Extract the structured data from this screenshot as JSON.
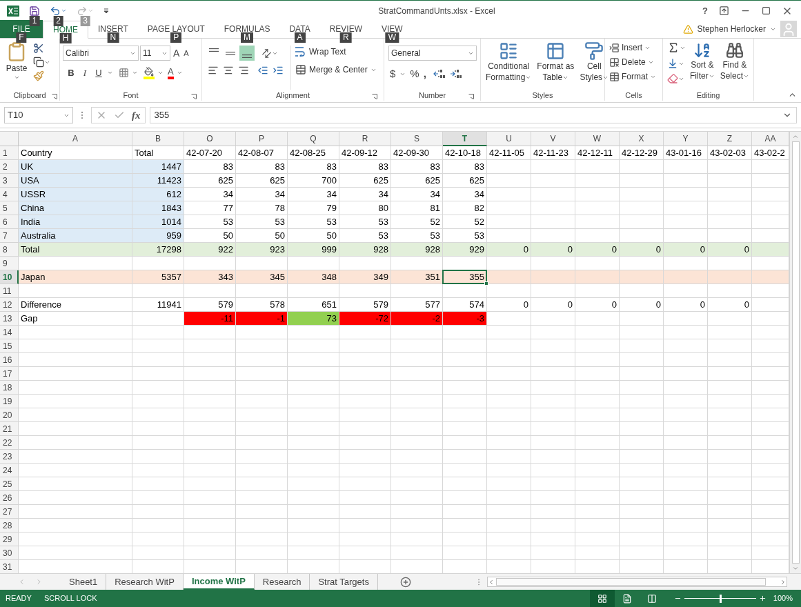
{
  "window": {
    "title": "StratCommandUnts.xlsx - Excel",
    "help": "?"
  },
  "quick_access": [
    {
      "kind": "save",
      "key_tip": "1",
      "disabled": false
    },
    {
      "kind": "undo",
      "key_tip": "2",
      "disabled": false
    },
    {
      "kind": "redo",
      "key_tip": "3",
      "disabled": true
    }
  ],
  "tabs": [
    {
      "kind": "file",
      "label": "FILE",
      "key_tip": "F",
      "selected": false
    },
    {
      "kind": "tab",
      "label": "HOME",
      "key_tip": "H",
      "selected": true
    },
    {
      "kind": "tab",
      "label": "INSERT",
      "key_tip": "N",
      "selected": false
    },
    {
      "kind": "tab",
      "label": "PAGE LAYOUT",
      "key_tip": "P",
      "selected": false
    },
    {
      "kind": "tab",
      "label": "FORMULAS",
      "key_tip": "M",
      "selected": false
    },
    {
      "kind": "tab",
      "label": "DATA",
      "key_tip": "A",
      "selected": false
    },
    {
      "kind": "tab",
      "label": "REVIEW",
      "key_tip": "R",
      "selected": false
    },
    {
      "kind": "tab",
      "label": "VIEW",
      "key_tip": "W",
      "selected": false
    }
  ],
  "user": {
    "name": "Stephen Herlocker"
  },
  "ribbon": {
    "groups": [
      {
        "kind": "clipboard",
        "title": "Clipboard",
        "paste": "Paste"
      },
      {
        "kind": "font",
        "title": "Font",
        "font_name": "Calibri",
        "font_size": "11",
        "grow": "A",
        "shrink": "A",
        "styles": [
          "B",
          "I",
          "U"
        ],
        "font_color": "A"
      },
      {
        "kind": "alignment",
        "title": "Alignment",
        "vertical": [
          {
            "selected": false
          },
          {
            "selected": false
          },
          {
            "selected": true
          }
        ],
        "wrap_text": "Wrap Text",
        "merge": "Merge & Center"
      },
      {
        "kind": "number",
        "title": "Number",
        "format": "General",
        "symbols": [
          "$",
          "%",
          ","
        ]
      },
      {
        "kind": "styles",
        "title": "Styles",
        "buttons": [
          {
            "lines": [
              "Conditional",
              "Formatting"
            ]
          },
          {
            "lines": [
              "Format as",
              "Table"
            ]
          },
          {
            "lines": [
              "Cell",
              "Styles"
            ]
          }
        ]
      },
      {
        "kind": "cells",
        "title": "Cells",
        "buttons": [
          "Insert",
          "Delete",
          "Format"
        ]
      },
      {
        "kind": "editing",
        "title": "Editing",
        "buttons": [
          {
            "lines": [
              "Sort &",
              "Filter"
            ]
          },
          {
            "lines": [
              "Find &",
              "Select"
            ]
          }
        ]
      }
    ]
  },
  "formula_bar": {
    "name_box": "T10",
    "function_label": "fx",
    "value": "355"
  },
  "sheet": {
    "columns": [
      {
        "label": "A",
        "selected": false
      },
      {
        "label": "B",
        "selected": false
      },
      {
        "label": "O",
        "selected": false
      },
      {
        "label": "P",
        "selected": false
      },
      {
        "label": "Q",
        "selected": false
      },
      {
        "label": "R",
        "selected": false
      },
      {
        "label": "S",
        "selected": false
      },
      {
        "label": "T",
        "selected": true
      },
      {
        "label": "U",
        "selected": false
      },
      {
        "label": "V",
        "selected": false
      },
      {
        "label": "W",
        "selected": false
      },
      {
        "label": "X",
        "selected": false
      },
      {
        "label": "Y",
        "selected": false
      },
      {
        "label": "Z",
        "selected": false
      },
      {
        "label": "AA",
        "selected": false
      }
    ],
    "rows": [
      {
        "label": "1",
        "selected": false,
        "cells": [
          {
            "text": "Country"
          },
          {
            "text": "Total"
          },
          {
            "text": "42-07-20"
          },
          {
            "text": "42-08-07"
          },
          {
            "text": "42-08-25"
          },
          {
            "text": "42-09-12"
          },
          {
            "text": "42-09-30"
          },
          {
            "text": "42-10-18"
          },
          {
            "text": "42-11-05"
          },
          {
            "text": "42-11-23"
          },
          {
            "text": "42-12-11"
          },
          {
            "text": "42-12-29"
          },
          {
            "text": "43-01-16"
          },
          {
            "text": "43-02-03"
          },
          {
            "text": "43-02-2"
          }
        ]
      },
      {
        "label": "2",
        "selected": false,
        "cells": [
          {
            "text": "UK",
            "color": "#ddebf7"
          },
          {
            "text": "1447",
            "color": "#ddebf7"
          },
          {
            "text": "83"
          },
          {
            "text": "83"
          },
          {
            "text": "83"
          },
          {
            "text": "83"
          },
          {
            "text": "83"
          },
          {
            "text": "83"
          }
        ]
      },
      {
        "label": "3",
        "selected": false,
        "cells": [
          {
            "text": "USA",
            "color": "#ddebf7"
          },
          {
            "text": "11423",
            "color": "#ddebf7"
          },
          {
            "text": "625"
          },
          {
            "text": "625"
          },
          {
            "text": "700"
          },
          {
            "text": "625"
          },
          {
            "text": "625"
          },
          {
            "text": "625"
          }
        ]
      },
      {
        "label": "4",
        "selected": false,
        "cells": [
          {
            "text": "USSR",
            "color": "#ddebf7"
          },
          {
            "text": "612",
            "color": "#ddebf7"
          },
          {
            "text": "34"
          },
          {
            "text": "34"
          },
          {
            "text": "34"
          },
          {
            "text": "34"
          },
          {
            "text": "34"
          },
          {
            "text": "34"
          }
        ]
      },
      {
        "label": "5",
        "selected": false,
        "cells": [
          {
            "text": "China",
            "color": "#ddebf7"
          },
          {
            "text": "1843",
            "color": "#ddebf7"
          },
          {
            "text": "77"
          },
          {
            "text": "78"
          },
          {
            "text": "79"
          },
          {
            "text": "80"
          },
          {
            "text": "81"
          },
          {
            "text": "82"
          }
        ]
      },
      {
        "label": "6",
        "selected": false,
        "cells": [
          {
            "text": "India",
            "color": "#ddebf7"
          },
          {
            "text": "1014",
            "color": "#ddebf7"
          },
          {
            "text": "53"
          },
          {
            "text": "53"
          },
          {
            "text": "53"
          },
          {
            "text": "53"
          },
          {
            "text": "52"
          },
          {
            "text": "52"
          }
        ]
      },
      {
        "label": "7",
        "selected": false,
        "cells": [
          {
            "text": "Australia",
            "color": "#ddebf7"
          },
          {
            "text": "959",
            "color": "#ddebf7"
          },
          {
            "text": "50"
          },
          {
            "text": "50"
          },
          {
            "text": "50"
          },
          {
            "text": "53"
          },
          {
            "text": "53"
          },
          {
            "text": "53"
          }
        ]
      },
      {
        "label": "8",
        "selected": false,
        "cells": [
          {
            "text": "Total",
            "color": "#e2efda"
          },
          {
            "text": "17298",
            "color": "#e2efda"
          },
          {
            "text": "922",
            "color": "#e2efda"
          },
          {
            "text": "923",
            "color": "#e2efda"
          },
          {
            "text": "999",
            "color": "#e2efda"
          },
          {
            "text": "928",
            "color": "#e2efda"
          },
          {
            "text": "928",
            "color": "#e2efda"
          },
          {
            "text": "929",
            "color": "#e2efda"
          },
          {
            "text": "0",
            "color": "#e2efda"
          },
          {
            "text": "0",
            "color": "#e2efda"
          },
          {
            "text": "0",
            "color": "#e2efda"
          },
          {
            "text": "0",
            "color": "#e2efda"
          },
          {
            "text": "0",
            "color": "#e2efda"
          },
          {
            "text": "0",
            "color": "#e2efda"
          },
          {
            "color": "#e2efda"
          }
        ]
      },
      {
        "label": "9",
        "selected": false
      },
      {
        "label": "10",
        "selected": true,
        "cells": [
          {
            "text": "Japan",
            "color": "#fce4d6"
          },
          {
            "text": "5357",
            "color": "#fce4d6"
          },
          {
            "text": "343",
            "color": "#fce4d6"
          },
          {
            "text": "345",
            "color": "#fce4d6"
          },
          {
            "text": "348",
            "color": "#fce4d6"
          },
          {
            "text": "349",
            "color": "#fce4d6"
          },
          {
            "text": "351",
            "color": "#fce4d6"
          },
          {
            "text": "355",
            "color": "#fce4d6",
            "active": true
          },
          {
            "color": "#fce4d6"
          },
          {
            "color": "#fce4d6"
          },
          {
            "color": "#fce4d6"
          },
          {
            "color": "#fce4d6"
          },
          {
            "color": "#fce4d6"
          },
          {
            "color": "#fce4d6"
          },
          {
            "color": "#fce4d6"
          }
        ]
      },
      {
        "label": "11",
        "selected": false
      },
      {
        "label": "12",
        "selected": false,
        "cells": [
          {
            "text": "Difference"
          },
          {
            "text": "11941"
          },
          {
            "text": "579"
          },
          {
            "text": "578"
          },
          {
            "text": "651"
          },
          {
            "text": "579"
          },
          {
            "text": "577"
          },
          {
            "text": "574"
          },
          {
            "text": "0"
          },
          {
            "text": "0"
          },
          {
            "text": "0"
          },
          {
            "text": "0"
          },
          {
            "text": "0"
          },
          {
            "text": "0"
          }
        ]
      },
      {
        "label": "13",
        "selected": false,
        "cells": [
          {
            "text": "Gap"
          },
          null,
          {
            "text": "-11",
            "color": "#ff0000"
          },
          {
            "text": "-1",
            "color": "#ff0000"
          },
          {
            "text": "73",
            "color": "#92d050"
          },
          {
            "text": "-72",
            "color": "#ff0000"
          },
          {
            "text": "-2",
            "color": "#ff0000"
          },
          {
            "text": "-3",
            "color": "#ff0000"
          }
        ]
      },
      {
        "label": "14",
        "selected": false
      },
      {
        "label": "15",
        "selected": false
      },
      {
        "label": "16",
        "selected": false
      },
      {
        "label": "17",
        "selected": false
      },
      {
        "label": "18",
        "selected": false
      },
      {
        "label": "19",
        "selected": false
      },
      {
        "label": "20",
        "selected": false
      },
      {
        "label": "21",
        "selected": false
      },
      {
        "label": "22",
        "selected": false
      },
      {
        "label": "23",
        "selected": false
      },
      {
        "label": "24",
        "selected": false
      },
      {
        "label": "25",
        "selected": false
      },
      {
        "label": "26",
        "selected": false
      },
      {
        "label": "27",
        "selected": false
      },
      {
        "label": "28",
        "selected": false
      },
      {
        "label": "29",
        "selected": false
      },
      {
        "label": "30",
        "selected": false
      },
      {
        "label": "31",
        "selected": false
      }
    ]
  },
  "sheet_tabs": [
    {
      "label": "Sheet1",
      "selected": false
    },
    {
      "label": "Research WitP",
      "selected": false
    },
    {
      "label": "Income WitP",
      "selected": true
    },
    {
      "label": "Research",
      "selected": false
    },
    {
      "label": "Strat Targets",
      "selected": false
    }
  ],
  "status_bar": {
    "items": [
      "READY",
      "SCROLL LOCK"
    ],
    "views": [
      {
        "selected": true
      },
      {
        "selected": false
      },
      {
        "selected": false
      }
    ],
    "zoom_slider": {
      "level": 0.5
    },
    "zoom": "100%"
  }
}
